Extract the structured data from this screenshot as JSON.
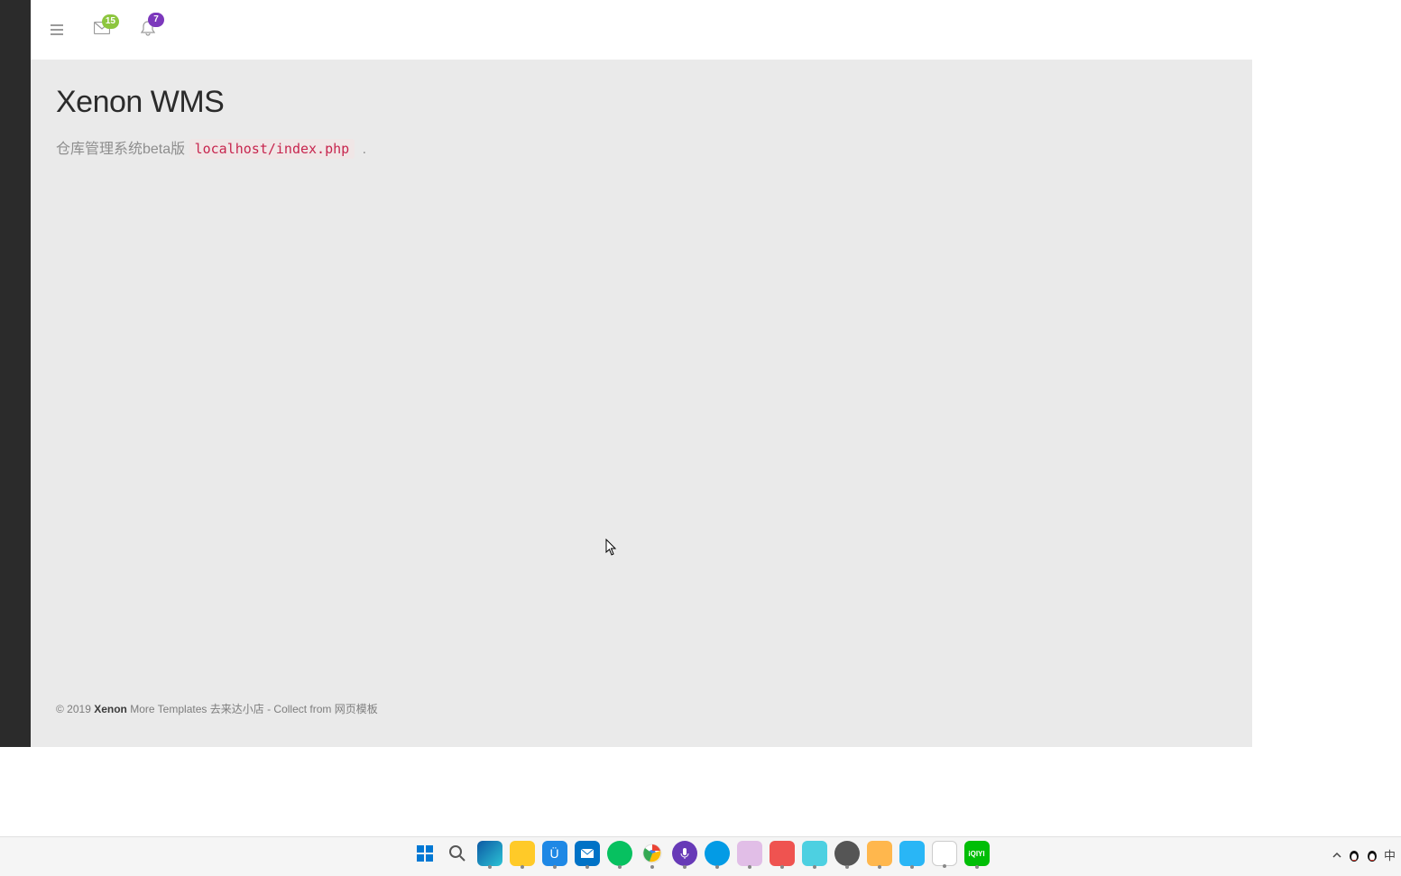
{
  "header": {
    "mail_badge": "15",
    "bell_badge": "7"
  },
  "page": {
    "title": "Xenon WMS",
    "subtitle_prefix": "仓库管理系统beta版 ",
    "subtitle_code": "localhost/index.php",
    "subtitle_suffix": " ."
  },
  "footer": {
    "copyright_prefix": "© 2019 ",
    "brand": "Xenon",
    "text1": " More Templates ",
    "link1": "去来达小店",
    "text2": " - Collect from ",
    "link2": "网页模板"
  },
  "taskbar": {
    "ime": "中"
  }
}
